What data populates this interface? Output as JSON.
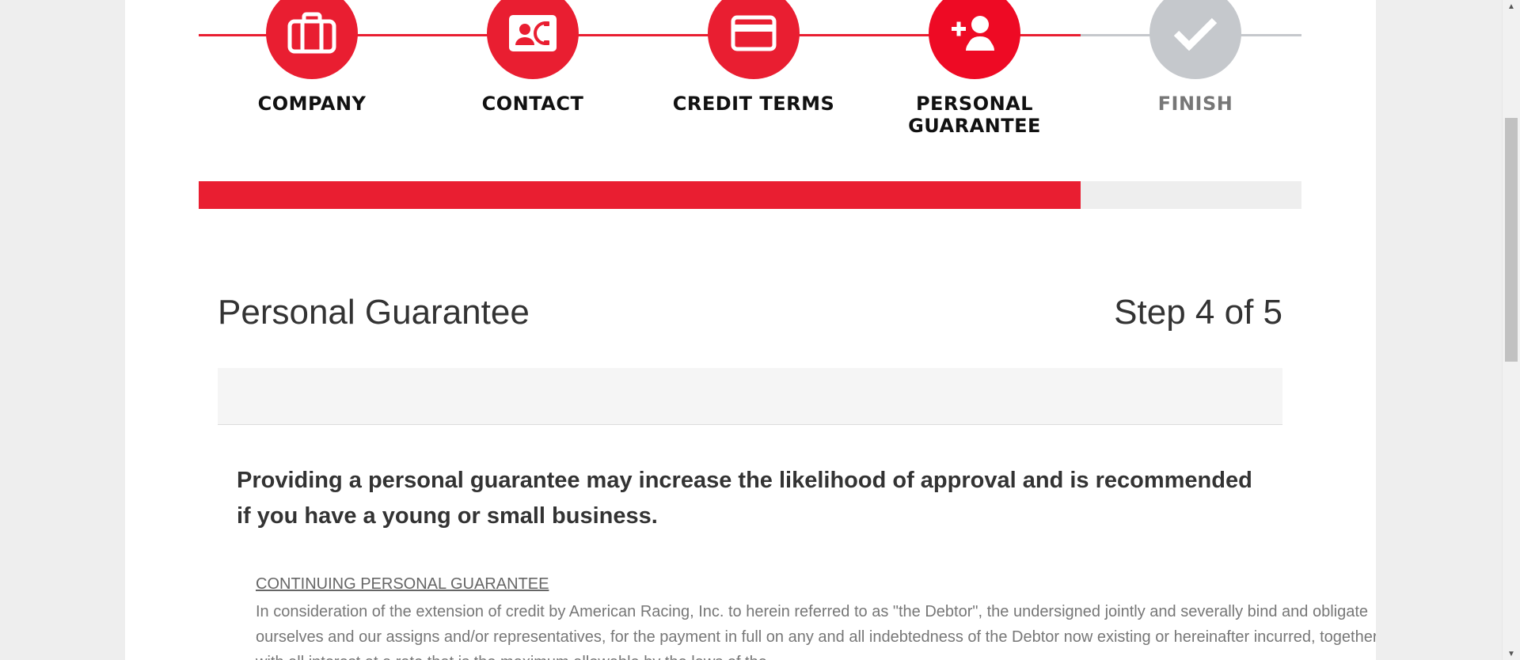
{
  "stepper": {
    "steps": [
      {
        "label": "COMPANY",
        "icon": "briefcase-icon",
        "state": "complete"
      },
      {
        "label": "CONTACT",
        "icon": "contact-card-icon",
        "state": "complete"
      },
      {
        "label": "CREDIT TERMS",
        "icon": "credit-card-icon",
        "state": "complete"
      },
      {
        "label": "PERSONAL GUARANTEE",
        "icon": "add-user-icon",
        "state": "current"
      },
      {
        "label": "FINISH",
        "icon": "checkmark-icon",
        "state": "pending"
      }
    ],
    "colors": {
      "complete": "#e91e31",
      "current": "#ee0a24",
      "pending": "#c5c8cc",
      "label_active": "#111111",
      "label_pending": "#777777"
    }
  },
  "progress": {
    "percent": 80,
    "color": "#e91e31"
  },
  "section": {
    "title": "Personal Guarantee",
    "step_text": "Step 4 of 5"
  },
  "intro_text": "Providing a personal guarantee may increase the likelihood of approval and is recommended if you have a young or small business.",
  "terms": {
    "heading": "CONTINUING PERSONAL GUARANTEE",
    "body": "In consideration of the extension of credit by American Racing, Inc. to herein referred to as \"the Debtor\", the undersigned jointly and severally bind and obligate ourselves and our assigns and/or representatives, for the payment in full on any and all indebtedness of the Debtor now existing or hereinafter incurred, together with all interest at a rate that is the maximum allowable by the laws of the"
  }
}
